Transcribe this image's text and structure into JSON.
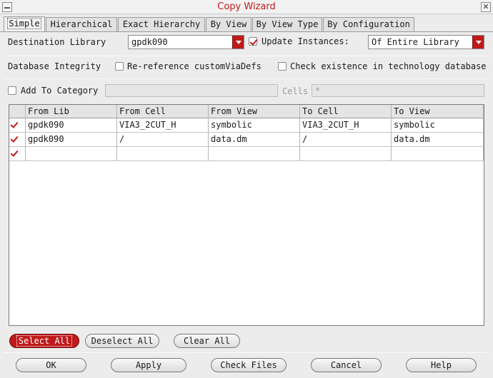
{
  "window": {
    "title": "Copy Wizard",
    "close_glyph": "✕"
  },
  "tabs": [
    {
      "label": "Simple",
      "active": true
    },
    {
      "label": "Hierarchical",
      "active": false
    },
    {
      "label": "Exact Hierarchy",
      "active": false
    },
    {
      "label": "By View",
      "active": false
    },
    {
      "label": "By View Type",
      "active": false
    },
    {
      "label": "By Configuration",
      "active": false
    }
  ],
  "destination": {
    "label": "Destination Library",
    "value": "gpdk090",
    "update_instances": {
      "label": "Update Instances:",
      "checked": true
    },
    "scope_value": "Of Entire Library"
  },
  "integrity": {
    "label": "Database Integrity",
    "rereference": {
      "label": "Re-reference customViaDefs",
      "checked": false
    },
    "check_tech": {
      "label": "Check existence in technology database",
      "checked": false
    }
  },
  "category": {
    "add_label": "Add To Category",
    "checked": false,
    "value": "",
    "cells_label": "Cells",
    "cells_value": "*"
  },
  "table": {
    "columns": [
      "From Lib",
      "From Cell",
      "From View",
      "To Cell",
      "To View"
    ],
    "rows": [
      {
        "checked": true,
        "cells": [
          "gpdk090",
          "VIA3_2CUT_H",
          "symbolic",
          "VIA3_2CUT_H",
          "symbolic"
        ]
      },
      {
        "checked": true,
        "cells": [
          "gpdk090",
          "/",
          "data.dm",
          "/",
          "data.dm"
        ]
      },
      {
        "checked": true,
        "cells": [
          "",
          "",
          "",
          "",
          ""
        ]
      }
    ]
  },
  "selection": {
    "select_all": "Select All",
    "deselect_all": "Deselect All",
    "clear_all": "Clear All"
  },
  "footer": {
    "ok": "OK",
    "apply": "Apply",
    "check_files": "Check Files",
    "cancel": "Cancel",
    "help": "Help"
  },
  "colors": {
    "accent": "#c01a1a",
    "title_text": "#c21a1a"
  }
}
